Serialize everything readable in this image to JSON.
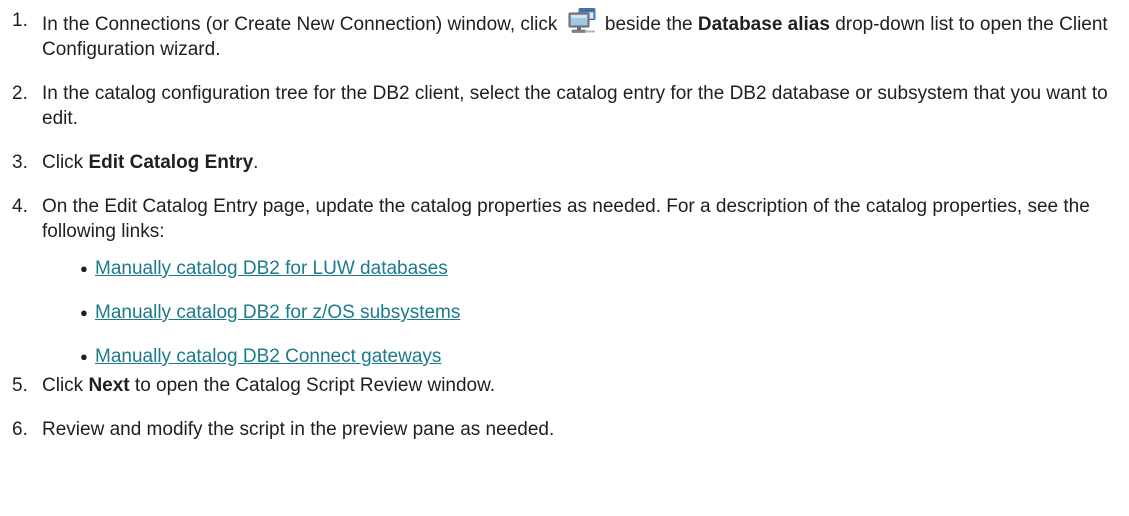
{
  "colors": {
    "text": "#1f1f1f",
    "link": "#1c7a8c"
  },
  "steps": [
    {
      "number": "1.",
      "before_icon": "In the Connections (or Create New Connection) window, click",
      "icon": "client-configuration-icon",
      "after_icon": "beside the",
      "bold": "Database alias",
      "after_bold": "drop-down list to open the Client Configuration wizard."
    },
    {
      "number": "2.",
      "text": "In the catalog configuration tree for the DB2 client, select the catalog entry for the DB2 database or subsystem that you want to edit."
    },
    {
      "number": "3.",
      "before_bold": "Click",
      "bold": "Edit Catalog Entry",
      "after_bold": "."
    },
    {
      "number": "4.",
      "text": "On the Edit Catalog Entry page, update the catalog properties as needed. For a description of the catalog properties, see the following links:",
      "links": [
        "Manually catalog DB2 for LUW databases",
        "Manually catalog DB2 for z/OS subsystems",
        "Manually catalog DB2 Connect gateways"
      ]
    },
    {
      "number": "5.",
      "before_bold": "Click",
      "bold": "Next",
      "after_bold": "to open the Catalog Script Review window."
    },
    {
      "number": "6.",
      "text": "Review and modify the script in the preview pane as needed."
    }
  ]
}
